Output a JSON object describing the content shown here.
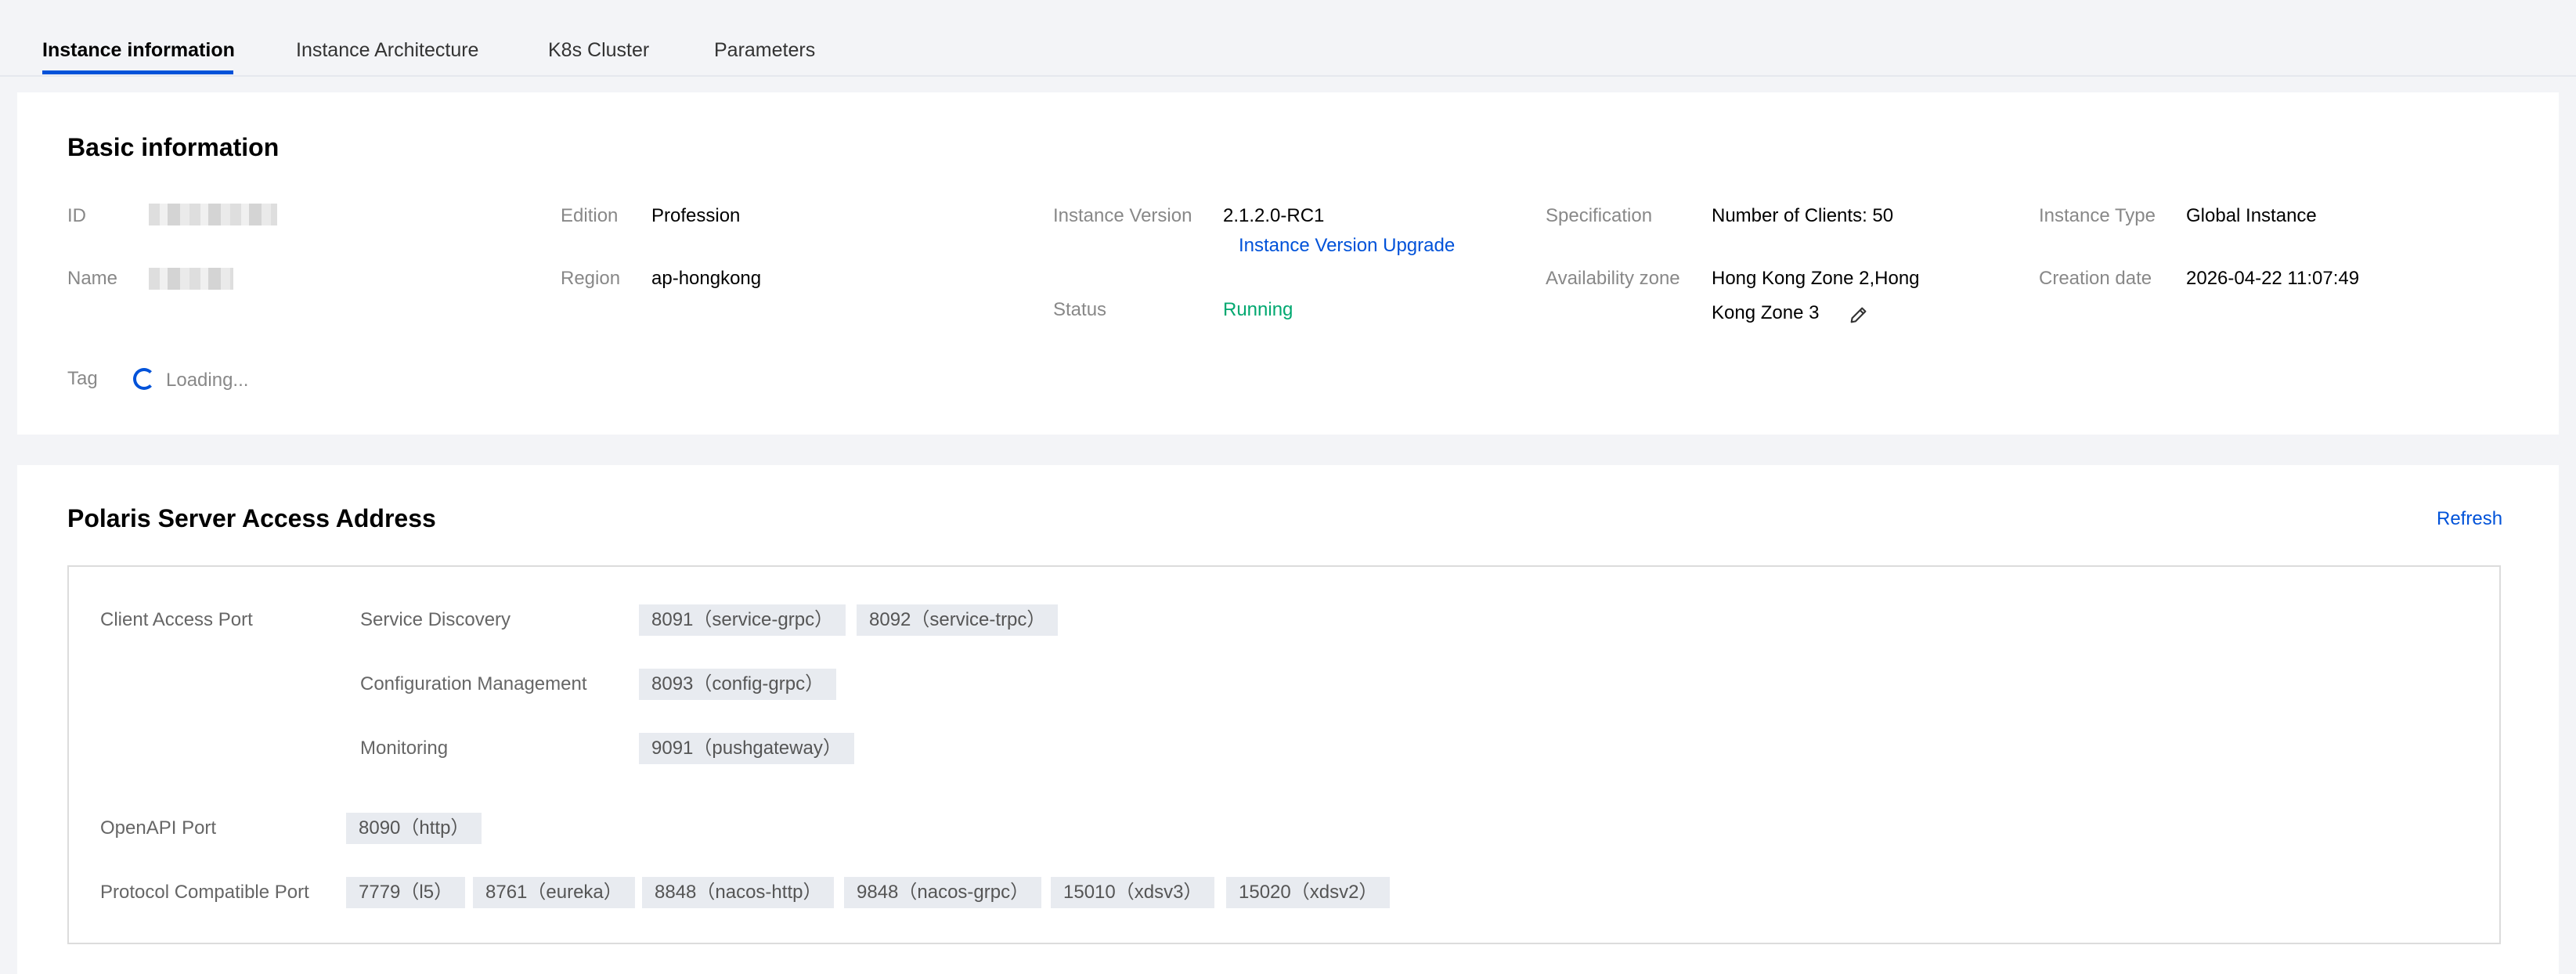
{
  "tabs": [
    {
      "label": "Instance information",
      "active": true
    },
    {
      "label": "Instance Architecture",
      "active": false
    },
    {
      "label": "K8s Cluster",
      "active": false
    },
    {
      "label": "Parameters",
      "active": false
    }
  ],
  "basic": {
    "title": "Basic information",
    "id_label": "ID",
    "name_label": "Name",
    "edition_label": "Edition",
    "edition_value": "Profession",
    "region_label": "Region",
    "region_value": "ap-hongkong",
    "version_label": "Instance Version",
    "version_value": "2.1.2.0-RC1",
    "upgrade_link": "Instance Version Upgrade",
    "status_label": "Status",
    "status_value": "Running",
    "spec_label": "Specification",
    "spec_value": "Number of Clients: 50",
    "az_label": "Availability zone",
    "az_value_line1": "Hong Kong Zone 2,Hong",
    "az_value_line2": "Kong Zone 3",
    "type_label": "Instance Type",
    "type_value": "Global Instance",
    "date_label": "Creation date",
    "date_value": "2026-04-22 11:07:49",
    "tag_label": "Tag",
    "tag_loading": "Loading..."
  },
  "polaris": {
    "title": "Polaris Server Access Address",
    "refresh": "Refresh",
    "client_access_label": "Client Access Port",
    "service_discovery_label": "Service Discovery",
    "service_discovery_ports": [
      "8091（service-grpc）",
      "8092（service-trpc）"
    ],
    "config_mgmt_label": "Configuration Management",
    "config_mgmt_ports": [
      "8093（config-grpc）"
    ],
    "monitoring_label": "Monitoring",
    "monitoring_ports": [
      "9091（pushgateway）"
    ],
    "openapi_label": "OpenAPI Port",
    "openapi_ports": [
      "8090（http）"
    ],
    "protocol_label": "Protocol Compatible Port",
    "protocol_ports": [
      "7779（l5）",
      "8761（eureka）",
      "8848（nacos-http）",
      "9848（nacos-grpc）",
      "15010（xdsv3）",
      "15020（xdsv2）"
    ]
  },
  "colors": {
    "accent": "#0052d9",
    "success": "#00a870",
    "background": "#f3f4f7",
    "tag_bg": "#e8ebf0"
  },
  "icons": {
    "edit": "pencil-icon",
    "loading": "spinner-icon"
  }
}
